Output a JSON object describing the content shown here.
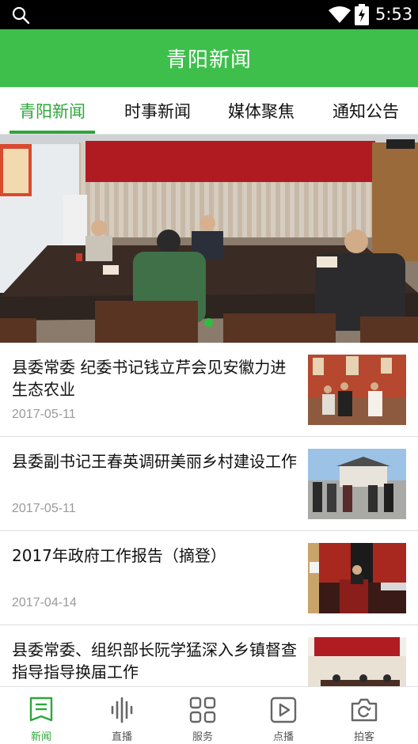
{
  "status_bar": {
    "time": "5:53"
  },
  "header": {
    "title": "青阳新闻"
  },
  "tabs": [
    {
      "label": "青阳新闻",
      "active": true
    },
    {
      "label": "时事新闻",
      "active": false
    },
    {
      "label": "媒体聚焦",
      "active": false
    },
    {
      "label": "通知公告",
      "active": false
    }
  ],
  "banner": {
    "page_indicator": {
      "current": 1,
      "total": 1
    }
  },
  "news": [
    {
      "headline": "县委常委 纪委书记钱立芹会见安徽力进生态农业",
      "date": "2017-05-11"
    },
    {
      "headline": "县委副书记王春英调研美丽乡村建设工作",
      "date": "2017-05-11"
    },
    {
      "headline": "2017年政府工作报告（摘登）",
      "date": "2017-04-14"
    },
    {
      "headline": "县委常委、组织部长阮学猛深入乡镇督查指导指导换届工作",
      "date": ""
    }
  ],
  "bottom_nav": [
    {
      "label": "新闻",
      "icon": "news-icon",
      "active": true
    },
    {
      "label": "直播",
      "icon": "live-icon",
      "active": false
    },
    {
      "label": "服务",
      "icon": "services-icon",
      "active": false
    },
    {
      "label": "点播",
      "icon": "vod-play-icon",
      "active": false
    },
    {
      "label": "拍客",
      "icon": "camera-icon",
      "active": false
    }
  ],
  "colors": {
    "brand_green": "#3ebf4c",
    "active_green": "#2fa63b",
    "status_bar": "#000000"
  }
}
